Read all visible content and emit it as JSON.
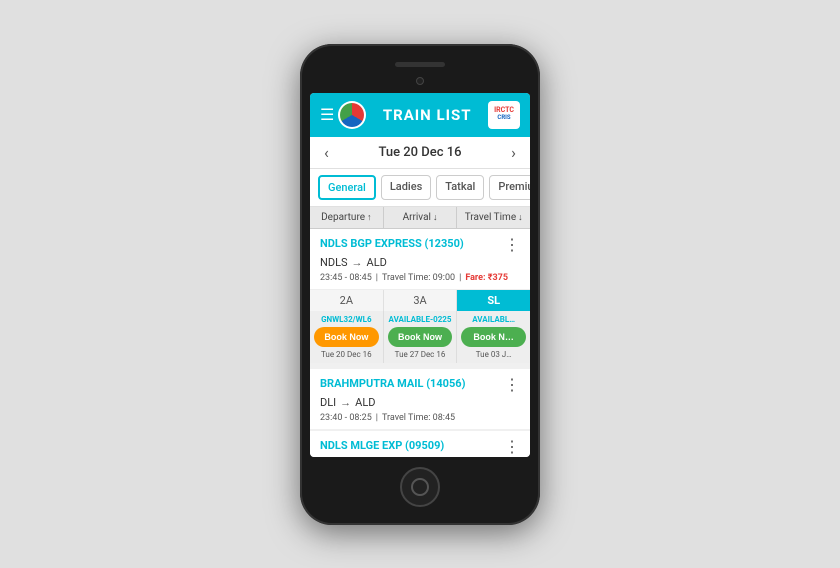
{
  "header": {
    "menu_icon": "☰",
    "title": "TRAIN LIST",
    "logo_line1": "IRCTC",
    "logo_line2": "CRIS"
  },
  "date_bar": {
    "prev_arrow": "‹",
    "date": "Tue 20 Dec 16",
    "next_arrow": "›"
  },
  "tabs": [
    {
      "label": "General",
      "active": true
    },
    {
      "label": "Ladies",
      "active": false
    },
    {
      "label": "Tatkal",
      "active": false
    },
    {
      "label": "Premium Tatk",
      "active": false
    }
  ],
  "sort_bar": [
    {
      "label": "Departure",
      "arrow": "↑"
    },
    {
      "label": "Arrival",
      "arrow": "↓"
    },
    {
      "label": "Travel Time",
      "arrow": "↓"
    }
  ],
  "trains": [
    {
      "name": "NDLS BGP EXPRESS  (12350)",
      "from": "NDLS",
      "to": "ALD",
      "times": "23:45 - 08:45",
      "travel_time": "Travel Time: 09:00",
      "fare": "Fare: ₹375",
      "classes": [
        "2A",
        "3A",
        "SL"
      ],
      "active_class": "SL",
      "availability": [
        {
          "label": "GNWL32/WL6",
          "btn": "Book Now",
          "btn_type": "orange",
          "date": "Tue 20 Dec 16"
        },
        {
          "label": "AVAILABLE-0225",
          "btn": "Book Now",
          "btn_type": "green",
          "date": "Tue 27 Dec 16"
        },
        {
          "label": "AVAILABL",
          "btn": "Book N",
          "btn_type": "green",
          "date": "Tue 03 J"
        }
      ]
    },
    {
      "name": "BRAHMPUTRA MAIL  (14056)",
      "from": "DLI",
      "to": "ALD",
      "times": "23:40 - 08:25",
      "travel_time": "Travel Time: 08:45",
      "fare": ""
    },
    {
      "name": "NDLS MLGE EXP  (09509)",
      "from": "",
      "to": "",
      "times": "",
      "travel_time": "",
      "fare": ""
    }
  ],
  "book_now_label": "Book Now",
  "book_short_label": "Book N"
}
